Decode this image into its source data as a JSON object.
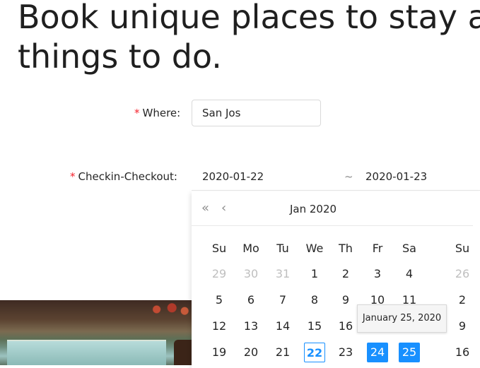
{
  "headline": {
    "line1": "Book unique places to stay ar",
    "line2": "things to do."
  },
  "form": {
    "where": {
      "required_mark": "*",
      "label": "Where:",
      "value": "San Jos"
    },
    "checkin": {
      "required_mark": "*",
      "label": "Checkin-Checkout:"
    }
  },
  "range": {
    "start": "2020-01-22",
    "separator": "~",
    "end": "2020-01-23"
  },
  "calendar": {
    "prev_year_glyph": "«",
    "prev_month_glyph": "‹",
    "month_title": "Jan 2020",
    "left_weekdays": [
      "Su",
      "Mo",
      "Tu",
      "We",
      "Th",
      "Fr",
      "Sa"
    ],
    "right_weekday": "Su",
    "weeks": [
      [
        "29",
        "30",
        "31",
        "1",
        "2",
        "3",
        "4"
      ],
      [
        "5",
        "6",
        "7",
        "8",
        "9",
        "10",
        "11"
      ],
      [
        "12",
        "13",
        "14",
        "15",
        "16",
        "",
        ""
      ],
      [
        "19",
        "20",
        "21",
        "22",
        "23",
        "24",
        "25"
      ]
    ],
    "right_column": [
      "26",
      "2",
      "9",
      "16"
    ],
    "tooltip": "January 25, 2020",
    "accent_color": "#1890ff"
  }
}
